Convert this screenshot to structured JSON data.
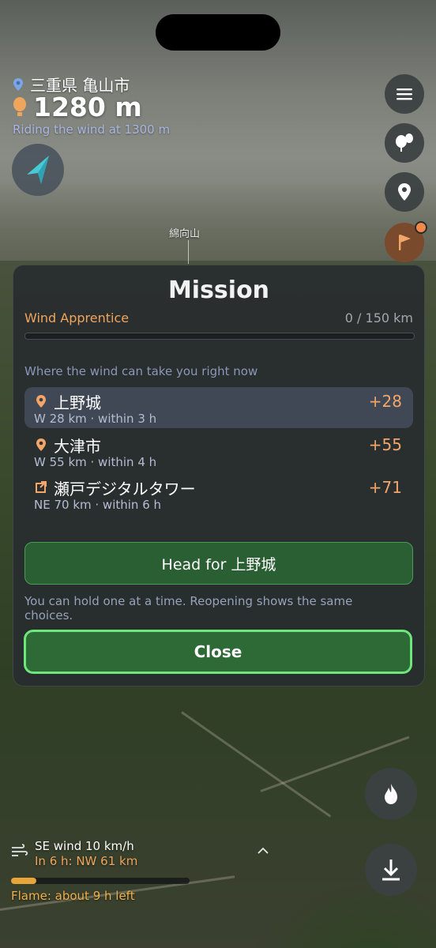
{
  "location": {
    "name": "三重県 亀山市",
    "pin_icon": "location-pin-icon"
  },
  "altitude": {
    "value": "1280 m",
    "icon": "balloon-icon"
  },
  "wind_status": "Riding the wind at 1300 m",
  "compass": {
    "icon": "compass-arrow-icon"
  },
  "map_label": "綿向山",
  "right_buttons": [
    {
      "name": "menu",
      "icon": "menu-icon"
    },
    {
      "name": "balloons",
      "icon": "balloons-icon"
    },
    {
      "name": "location",
      "icon": "map-pin-icon"
    },
    {
      "name": "mission",
      "icon": "flag-icon",
      "has_badge": true
    }
  ],
  "mission": {
    "title": "Mission",
    "rank": "Wind Apprentice",
    "progress_text": "0 / 150 km",
    "progress_fraction": 0,
    "subheading": "Where the wind can take you right now",
    "options": [
      {
        "name": "上野城",
        "detail": "W 28 km · within 3 h",
        "score": "+28",
        "icon": "location-pin-icon",
        "selected": true
      },
      {
        "name": "大津市",
        "detail": "W 55 km · within 4 h",
        "score": "+55",
        "icon": "location-pin-icon",
        "selected": false
      },
      {
        "name": "瀬戸デジタルタワー",
        "detail": "NE 70 km · within 6 h",
        "score": "+71",
        "icon": "landmark-icon",
        "selected": false
      }
    ],
    "head_for_label": "Head for 上野城",
    "note": "You can hold one at a time. Reopening shows the same choices.",
    "close_label": "Close"
  },
  "bottom": {
    "wind": "SE wind 10 km/h",
    "forecast": "In 6 h: NW 61 km",
    "flame_text": "Flame: about 9 h left",
    "flame_fraction": 0.14,
    "burn_icon": "flame-icon",
    "descend_icon": "descend-arrow-icon",
    "wind_icon": "wind-icon"
  },
  "colors": {
    "accent": "#f0a55c",
    "button_green": "#2e6a36",
    "close_border": "#6fe67c"
  }
}
